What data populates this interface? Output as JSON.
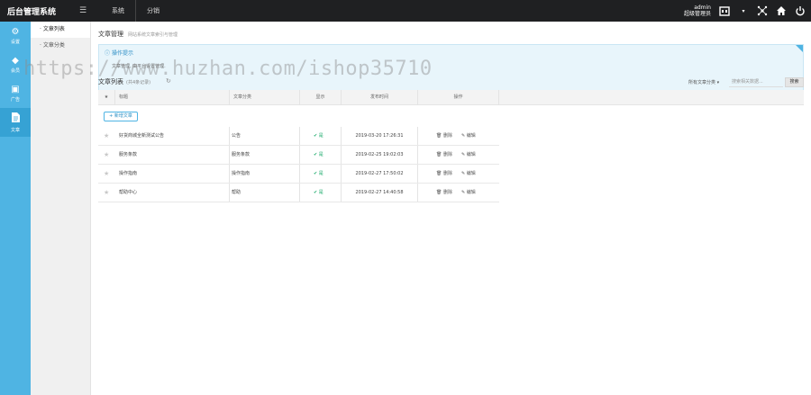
{
  "topbar": {
    "brand": "后台管理系统",
    "menu_icon": "hamburger-icon",
    "nav": [
      "系统",
      "分销"
    ],
    "admin_name": "admin",
    "admin_role": "超级管理员",
    "icons": [
      "shop-icon",
      "chevron-down-icon",
      "network-icon",
      "home-icon",
      "power-icon"
    ]
  },
  "sidebar": {
    "items": [
      {
        "label": "设置",
        "icon": "gear-icon"
      },
      {
        "label": "会员",
        "icon": "diamond-icon"
      },
      {
        "label": "广告",
        "icon": "billboard-icon"
      },
      {
        "label": "文章",
        "icon": "document-icon",
        "active": true
      }
    ]
  },
  "subnav": {
    "items": [
      "文章列表",
      "文章分类"
    ],
    "active_index": 0
  },
  "breadcrumb": {
    "title": "文章管理",
    "subtitle": "网站系统文章索引与管理"
  },
  "tips": {
    "header": "操作提示",
    "line": "文章管理, 由平台设置管理."
  },
  "list": {
    "title": "文章列表",
    "count_text": "(共4条记录)",
    "filter_label": "所有文章分类",
    "search_placeholder": "搜索相关数据...",
    "search_button": "搜索",
    "add_button": "+ 新增文章",
    "columns": [
      "标题",
      "文章分类",
      "显示",
      "发布时间",
      "操作"
    ],
    "rows": [
      {
        "title": "好货商城全新测试公告",
        "category": "公告",
        "show": "是",
        "date": "2019-03-20 17:26:31",
        "del": "删除",
        "edit": "编辑"
      },
      {
        "title": "服务条款",
        "category": "服务条款",
        "show": "是",
        "date": "2019-02-25 19:02:03",
        "del": "删除",
        "edit": "编辑"
      },
      {
        "title": "操作指南",
        "category": "操作指南",
        "show": "是",
        "date": "2019-02-27 17:50:02",
        "del": "删除",
        "edit": "编辑"
      },
      {
        "title": "帮助中心",
        "category": "帮助",
        "show": "是",
        "date": "2019-02-27 14:40:58",
        "del": "删除",
        "edit": "编辑"
      }
    ]
  },
  "watermark": "https://www.huzhan.com/ishop35710",
  "colors": {
    "topbar": "#1f2022",
    "sidebar": "#4fb4e3",
    "accent": "#2a8fc4",
    "ok": "#1aaa6a"
  }
}
